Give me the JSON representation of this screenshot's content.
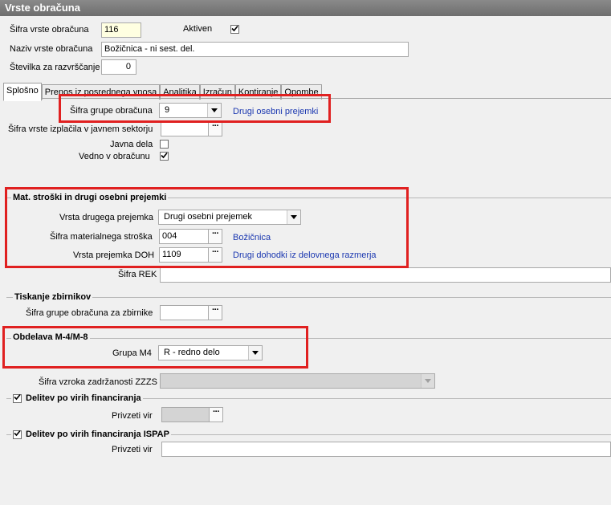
{
  "window": {
    "title": "Vrste obračuna"
  },
  "header": {
    "sifra_label": "Šifra vrste obračuna",
    "sifra_value": "116",
    "aktiven_label": "Aktiven",
    "aktiven_checked": true,
    "naziv_label": "Naziv vrste obračuna",
    "naziv_value": "Božičnica - ni sest. del.",
    "stevilka_label": "Številka  za razvrščanje",
    "stevilka_value": "0"
  },
  "tabs": [
    {
      "label": "Splošno",
      "active": true
    },
    {
      "label": "Prenos iz posrednega vnosa",
      "active": false
    },
    {
      "label": "Analitika",
      "active": false
    },
    {
      "label": "Izračun",
      "active": false
    },
    {
      "label": "Kontiranje",
      "active": false
    },
    {
      "label": "Opombe",
      "active": false
    }
  ],
  "general": {
    "grupa_label": "Šifra grupe obračuna",
    "grupa_value": "9",
    "grupa_desc": "Drugi osebni prejemki",
    "izplacila_label": "Šifra vrste izplačila v javnem sektorju",
    "izplacila_value": "",
    "javna_dela_label": "Javna dela",
    "javna_dela_checked": false,
    "vedno_label": "Vedno v obračunu",
    "vedno_checked": true
  },
  "mat_group": {
    "title": "Mat. stroški in drugi osebni prejemki",
    "vrsta_label": "Vrsta drugega prejemka",
    "vrsta_value": "Drugi osebni prejemek",
    "sifra_mat_label": "Šifra materialnega stroška",
    "sifra_mat_value": "004",
    "sifra_mat_desc": "Božičnica",
    "doh_label": "Vrsta prejemka DOH",
    "doh_value": "1109",
    "doh_desc": "Drugi dohodki iz delovnega razmerja",
    "rek_label": "Šifra REK",
    "rek_value": ""
  },
  "tiskanje": {
    "title": "Tiskanje zbirnikov",
    "grupa_label": "Šifra grupe obračuna za zbirnike",
    "grupa_value": ""
  },
  "obdelava": {
    "title": "Obdelava M-4/M-8",
    "grupa_label": "Grupa M4",
    "grupa_value": "R - redno delo"
  },
  "zzzs": {
    "label": "Šifra vzroka zadržanosti ZZZS",
    "value": ""
  },
  "delitev": {
    "title": "Delitev po virih financiranja",
    "checked": true,
    "vir_label": "Privzeti vir",
    "vir_value": ""
  },
  "delitev_ispap": {
    "title": "Delitev po virih financiranja ISPAP",
    "checked": true,
    "vir_label": "Privzeti vir",
    "vir_value": ""
  },
  "colors": {
    "highlight": "#e02020",
    "link": "#1a37b0"
  }
}
